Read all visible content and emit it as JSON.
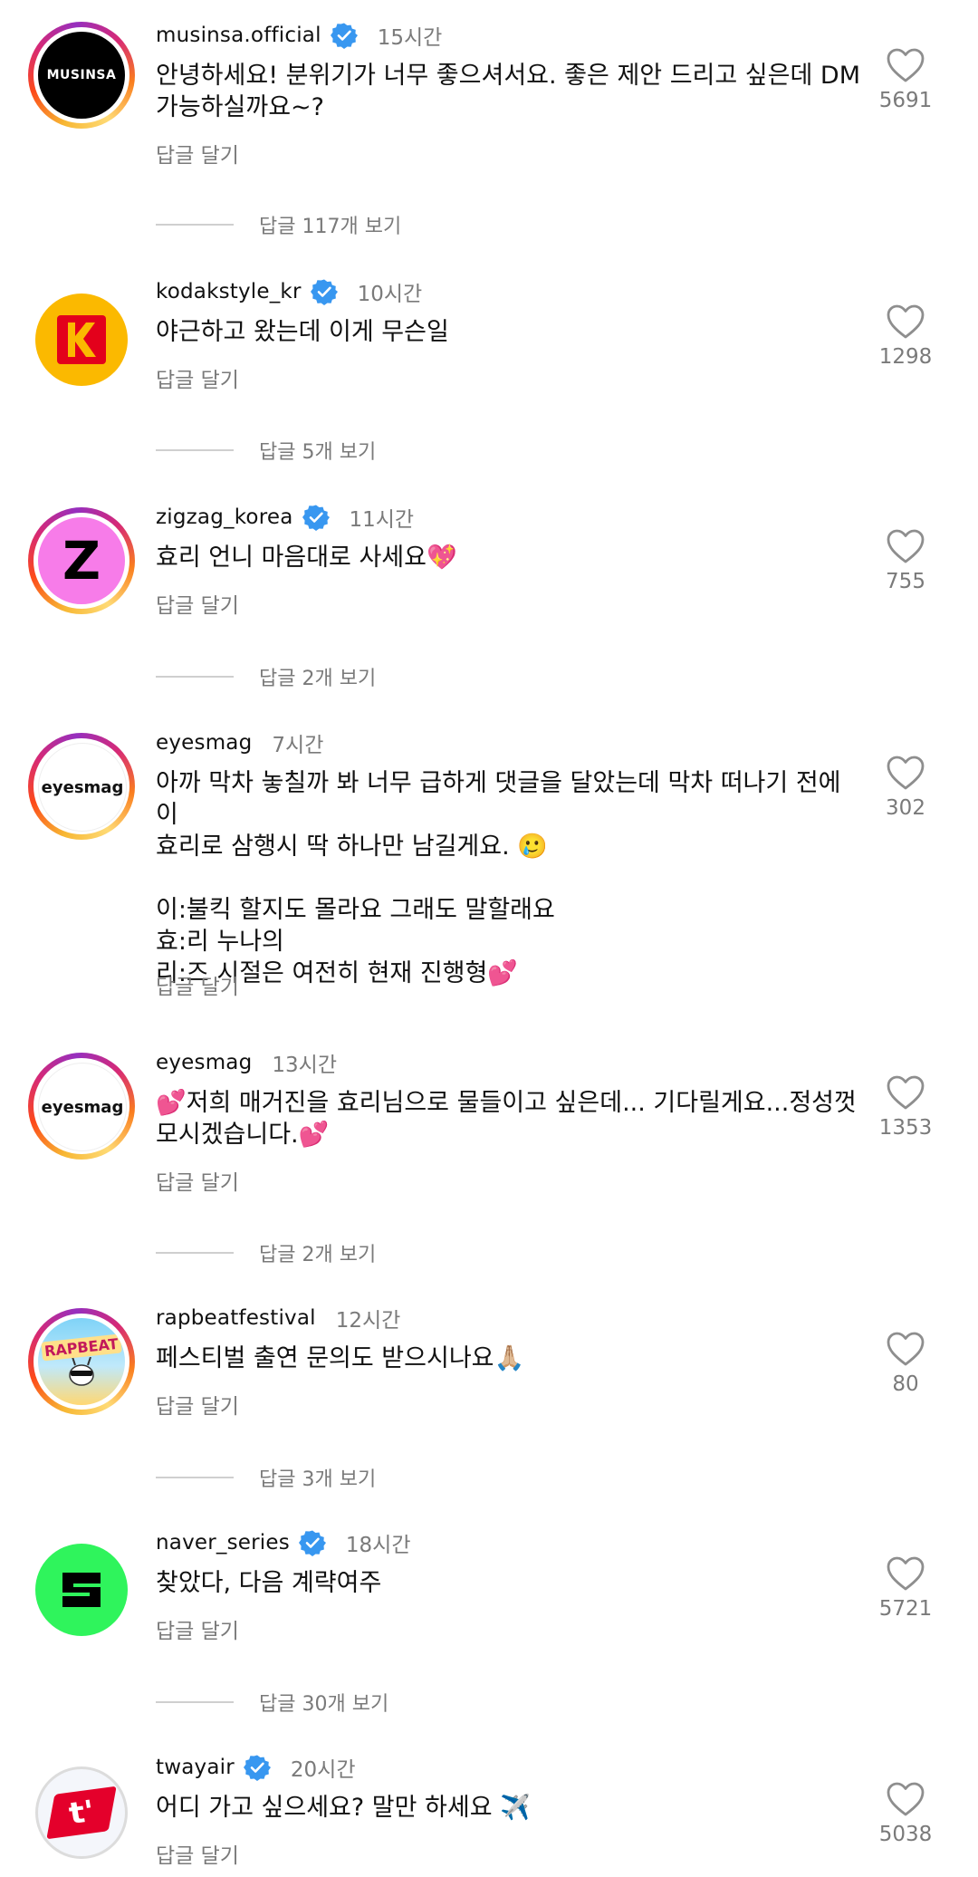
{
  "comments": [
    {
      "username": "musinsa.official",
      "verified": true,
      "time": "15시간",
      "text": "안녕하세요! 분위기가 너무 좋으셔서요. 좋은 제안 드리고 싶은데 DM\n가능하실까요~?",
      "reply": "답글 달기",
      "likes": "5691",
      "view_replies": "답글 117개 보기",
      "avatar_text": "MUSINSA"
    },
    {
      "username": "kodakstyle_kr",
      "verified": true,
      "time": "10시간",
      "text": "야근하고 왔는데 이게 무슨일",
      "reply": "답글 달기",
      "likes": "1298",
      "view_replies": "답글 5개 보기"
    },
    {
      "username": "zigzag_korea",
      "verified": true,
      "time": "11시간",
      "text": "효리 언니 마음대로 사세요💖",
      "reply": "답글 달기",
      "likes": "755",
      "view_replies": "답글 2개 보기",
      "avatar_text": "Z"
    },
    {
      "username": "eyesmag",
      "verified": false,
      "time": "7시간",
      "text": "아까 막차 놓칠까 봐 너무 급하게 댓글을 달았는데 막차 떠나기 전에 이\n효리로 삼행시 딱 하나만 남길게요. 🥲\n\n이:불킥 할지도 몰라요 그래도 말할래요\n효:리 누나의\n리:즈 시절은 여전히 현재 진행형💕",
      "reply": "답글 달기",
      "likes": "302",
      "avatar_text": "eyesmag"
    },
    {
      "username": "eyesmag",
      "verified": false,
      "time": "13시간",
      "text": "💕저희 매거진을 효리님으로 물들이고 싶은데... 기다릴게요...정성껏\n모시겠습니다.💕",
      "reply": "답글 달기",
      "likes": "1353",
      "view_replies": "답글 2개 보기",
      "avatar_text": "eyesmag"
    },
    {
      "username": "rapbeatfestival",
      "verified": false,
      "time": "12시간",
      "text": "페스티벌 출연 문의도 받으시나요🙏🏼",
      "reply": "답글 달기",
      "likes": "80",
      "view_replies": "답글 3개 보기",
      "avatar_text": "RAPBEAT"
    },
    {
      "username": "naver_series",
      "verified": true,
      "time": "18시간",
      "text": "찾았다, 다음 계략여주",
      "reply": "답글 달기",
      "likes": "5721",
      "view_replies": "답글 30개 보기"
    },
    {
      "username": "twayair",
      "verified": true,
      "time": "20시간",
      "text": "어디 가고 싶으세요? 말만 하세요 ✈️",
      "reply": "답글 달기",
      "likes": "5038",
      "avatar_text": "t'"
    }
  ],
  "colors": {
    "verified": "#3897f0",
    "muted": "#7a7a7a",
    "kodak_yellow": "#fbb900",
    "kodak_red": "#e3001b",
    "zigzag_pink": "#f77ce9",
    "naver_green": "#2ff45c",
    "tway_red": "#e4002b"
  }
}
